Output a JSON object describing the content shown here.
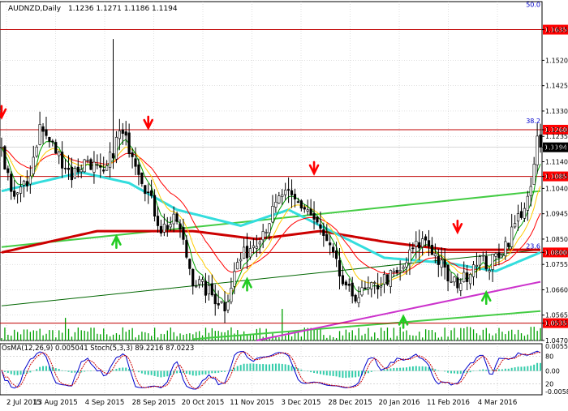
{
  "header": {
    "symbol": "AUDNZD,Daily",
    "ohlc": "1.1236 1.1271 1.1186 1.1194"
  },
  "colors": {
    "grid": "#c0c0c0",
    "bull": "#000000",
    "bear": "#000000",
    "level_line": "#c00000",
    "level_label_bg": "#ff0000",
    "price_label_bg": "#000000",
    "ema_fast": "#ff0000",
    "ema_mid": "#ffcc00",
    "ema_slow": "#00a000",
    "ema_200": "#cc0000",
    "ema_144": "#33dddd",
    "trend_green": "#44cc44",
    "trend_magenta": "#cc33cc",
    "trend_dark": "#006600",
    "arrow_down": "#ff0000",
    "arrow_up": "#22cc22",
    "osma_bar": "#33ccaa",
    "stoch_main": "#0000cc",
    "stoch_signal": "#cc0000"
  },
  "price_axis": {
    "min": 1.047,
    "max": 1.174,
    "ticks": [
      "1.1635",
      "1.1520",
      "1.1425",
      "1.1330",
      "1.1260",
      "1.1235",
      "1.1194",
      "1.1140",
      "1.1085",
      "1.1040",
      "1.0945",
      "1.0850",
      "1.0800",
      "1.0755",
      "1.0660",
      "1.0565",
      "1.0535",
      "1.0470"
    ]
  },
  "levels": [
    {
      "value": 1.1635,
      "label": "1.1635"
    },
    {
      "value": 1.126,
      "label": "1.1260"
    },
    {
      "value": 1.1085,
      "label": "1.1085"
    },
    {
      "value": 1.08,
      "label": "1.0800"
    },
    {
      "value": 1.0535,
      "label": "1.0535"
    }
  ],
  "current_price": {
    "value": 1.1194,
    "label": "1.1194"
  },
  "fib_labels": [
    {
      "text": "50.0",
      "value": 1.172
    },
    {
      "text": "38.2",
      "value": 1.1285
    },
    {
      "text": "23.6",
      "value": 1.0815
    }
  ],
  "date_axis": {
    "labels": [
      "2 Jul 2015",
      "13 Aug 2015",
      "4 Sep 2015",
      "28 Sep 2015",
      "20 Oct 2015",
      "11 Nov 2015",
      "3 Dec 2015",
      "28 Dec 2015",
      "20 Jan 2016",
      "11 Feb 2016",
      "4 Mar 2016"
    ]
  },
  "indicator": {
    "title": "OsMA(12,26,9) 0.005041  Stoch(5,3,3) 89.2216 87.0223",
    "axis": [
      "0.00554",
      "80",
      "0.00",
      "20",
      "-0.00585"
    ],
    "levels": {
      "upper": 80,
      "lower": 20
    }
  },
  "chart_data": {
    "type": "candlestick",
    "title": "AUDNZD,Daily",
    "bars": 170,
    "close_path": [
      [
        0,
        1.117
      ],
      [
        4,
        1.101
      ],
      [
        8,
        1.105
      ],
      [
        12,
        1.127
      ],
      [
        17,
        1.118
      ],
      [
        22,
        1.109
      ],
      [
        27,
        1.115
      ],
      [
        32,
        1.108
      ],
      [
        37,
        1.125
      ],
      [
        41,
        1.118
      ],
      [
        45,
        1.105
      ],
      [
        50,
        1.089
      ],
      [
        55,
        1.092
      ],
      [
        60,
        1.07
      ],
      [
        65,
        1.065
      ],
      [
        70,
        1.06
      ],
      [
        74,
        1.076
      ],
      [
        78,
        1.082
      ],
      [
        83,
        1.09
      ],
      [
        88,
        1.102
      ],
      [
        92,
        1.099
      ],
      [
        96,
        1.096
      ],
      [
        100,
        1.088
      ],
      [
        104,
        1.078
      ],
      [
        108,
        1.065
      ],
      [
        112,
        1.064
      ],
      [
        116,
        1.066
      ],
      [
        120,
        1.07
      ],
      [
        125,
        1.072
      ],
      [
        129,
        1.081
      ],
      [
        133,
        1.085
      ],
      [
        137,
        1.077
      ],
      [
        141,
        1.068
      ],
      [
        145,
        1.07
      ],
      [
        149,
        1.078
      ],
      [
        153,
        1.075
      ],
      [
        156,
        1.08
      ],
      [
        159,
        1.085
      ],
      [
        162,
        1.093
      ],
      [
        166,
        1.102
      ],
      [
        168,
        1.1236
      ],
      [
        169,
        1.1194
      ]
    ],
    "ema_200": [
      [
        0,
        1.08
      ],
      [
        30,
        1.088
      ],
      [
        45,
        1.088
      ],
      [
        60,
        1.088
      ],
      [
        80,
        1.085
      ],
      [
        100,
        1.088
      ],
      [
        120,
        1.084
      ],
      [
        140,
        1.081
      ],
      [
        169,
        1.081
      ]
    ],
    "ema_144": [
      [
        0,
        1.103
      ],
      [
        25,
        1.11
      ],
      [
        40,
        1.106
      ],
      [
        55,
        1.096
      ],
      [
        75,
        1.09
      ],
      [
        90,
        1.096
      ],
      [
        100,
        1.09
      ],
      [
        120,
        1.078
      ],
      [
        140,
        1.076
      ],
      [
        155,
        1.073
      ],
      [
        169,
        1.08
      ]
    ],
    "trendlines": [
      {
        "color": "trend_green",
        "points": [
          [
            0,
            1.082
          ],
          [
            169,
            1.103
          ]
        ]
      },
      {
        "color": "trend_green",
        "points": [
          [
            60,
            1.0475
          ],
          [
            169,
            1.058
          ]
        ]
      },
      {
        "color": "trend_magenta",
        "points": [
          [
            80,
            1.047
          ],
          [
            169,
            1.069
          ]
        ]
      },
      {
        "color": "trend_dark",
        "points": [
          [
            0,
            1.06
          ],
          [
            169,
            1.081
          ]
        ]
      }
    ],
    "signals": [
      {
        "type": "down",
        "bar": 0,
        "value": 1.13
      },
      {
        "type": "down",
        "bar": 46,
        "value": 1.126
      },
      {
        "type": "up",
        "bar": 36,
        "value": 1.086
      },
      {
        "type": "up",
        "bar": 77,
        "value": 1.07
      },
      {
        "type": "down",
        "bar": 98,
        "value": 1.109
      },
      {
        "type": "up",
        "bar": 126,
        "value": 1.056
      },
      {
        "type": "down",
        "bar": 143,
        "value": 1.087
      },
      {
        "type": "up",
        "bar": 152,
        "value": 1.065
      }
    ]
  }
}
